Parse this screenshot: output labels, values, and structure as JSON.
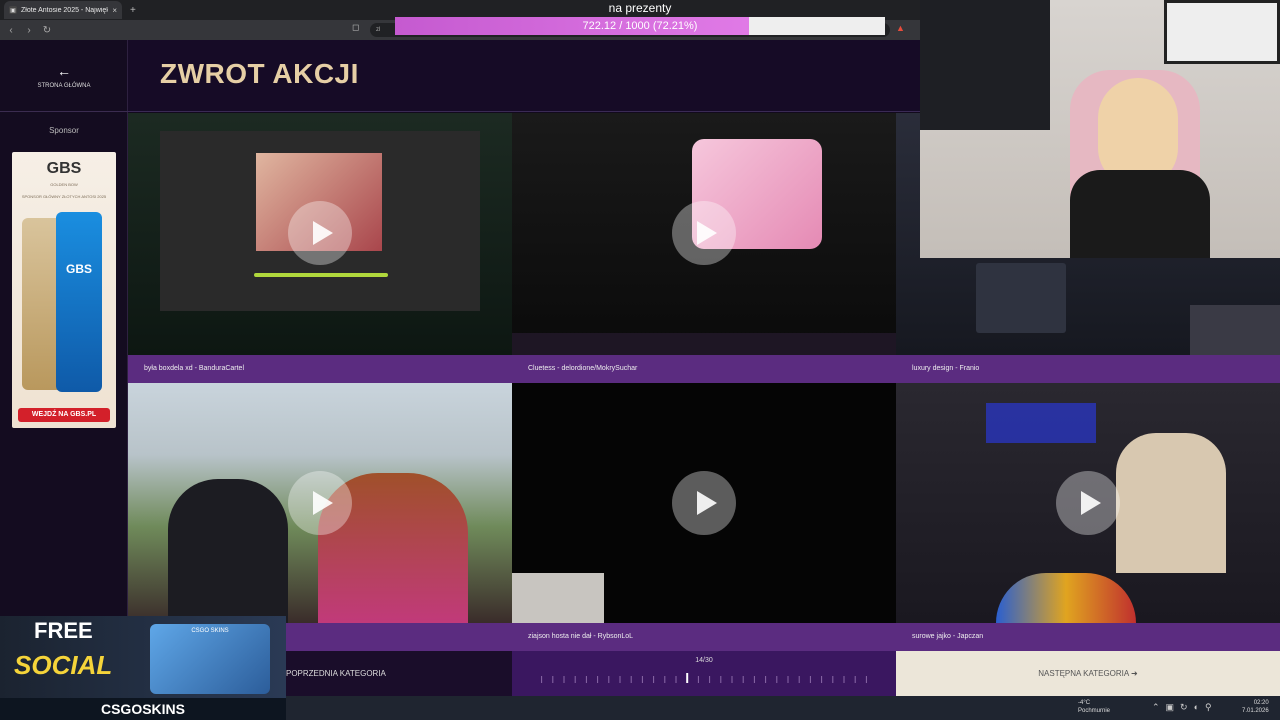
{
  "browser": {
    "tab_title": "Złote Antosie 2025 - Największ",
    "tab_close": "×",
    "new_tab": "+",
    "url": "zl"
  },
  "donation": {
    "title": "na prezenty",
    "progress_text": "722.12 / 1000 (72.21%)",
    "progress_fraction": 0.7221
  },
  "sidebar": {
    "back_label": "STRONA GŁÓWNA",
    "sponsor_label": "Sponsor",
    "ad": {
      "brand": "GBS",
      "brand_sub": "GOLDEN BOW",
      "tagline": "SPONSOR GŁÓWNY ZŁOTYCH ANTOSI 2025",
      "can_text": "GBS",
      "cta": "WEJDŹ NA GBS.PL"
    }
  },
  "header": {
    "title": "ZWROT AKCJI"
  },
  "nominees": [
    {
      "caption": "była boxdela xd - BanduraCartel"
    },
    {
      "caption": "Cluetess - delordione/MokrySuchar"
    },
    {
      "caption": "luxury design - Franio"
    },
    {
      "caption": ""
    },
    {
      "caption": "ziajson hosta nie dał - RybsonLoL"
    },
    {
      "caption": "surowe jajko - Japczan"
    }
  ],
  "nav": {
    "prev": "POPRZEDNIA KATEGORIA",
    "counter": "14/30",
    "current": 14,
    "total": 30,
    "next": "NASTĘPNA KATEGORIA"
  },
  "csgo": {
    "line1": "FREE",
    "line2": "SOCIAL",
    "chest_label": "CSGO SKINS",
    "brand": "CSGOSKINS"
  },
  "taskbar": {
    "temp": "-4°C",
    "weather": "Pochmurnie",
    "time": "02:20",
    "date": "7.01.2026"
  },
  "colors": {
    "accent": "#5b2c80",
    "title_gold": "#e6cfa5",
    "progress": "#c55ad0"
  }
}
